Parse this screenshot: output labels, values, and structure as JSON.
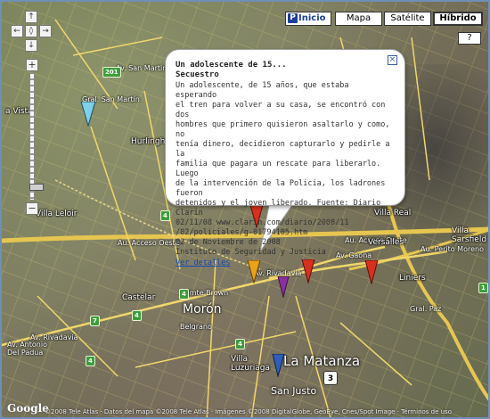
{
  "map_type_controls": {
    "home_label": "Inicio",
    "map_label": "Mapa",
    "satellite_label": "Satélite",
    "hybrid_label": "Híbrido",
    "active": "Híbrido",
    "help_label": "?"
  },
  "nav_controls": {
    "up": "↑",
    "down": "↓",
    "left": "←",
    "right": "→",
    "center": "◊"
  },
  "zoom_controls": {
    "in_label": "+",
    "out_label": "−",
    "level_fraction": 0.92
  },
  "info_window": {
    "title": "Un adolescente de 15...",
    "category": "Secuestro",
    "body_lines": [
      "Un adolescente, de 15 años, que estaba esperando",
      "el tren para volver a su casa, se encontró con dos",
      "hombres que primero quisieron asaltarlo y como, no",
      "tenía dinero, decidieron capturarlo y pedirle a la",
      "familia que pagara un rescate para liberarlo. Luego",
      "de la intervención de la Policía, los ladrones fueron",
      "detenidos y el joven liberado. Fuente: Diario Clarín",
      "02/11/08 www.clarin.com/diario/2008/11",
      "/02/policiales/g-01794105.htm",
      "02 de Noviembre de 2008",
      "Instituto de Seguridad y Justicia"
    ],
    "link_label": "Ver detalles",
    "close_label": "×"
  },
  "places": {
    "hurlingham": "Hurlingham",
    "villa_leloir": "Villa Leloir",
    "castelar": "Castelar",
    "moron": "Morón",
    "la_matanza": "La Matanza",
    "villa_luzuriaga": "Villa\nLuzuriaga",
    "san_justo": "San Justo",
    "villa_real": "Villa Real",
    "versalles": "Versalles",
    "liniers": "Liniers",
    "villa_sarsfield": "Villa\nSarsfield",
    "la_vista": "a Vista"
  },
  "streets": {
    "acceso_oeste_left": "Au. Acceso Oeste",
    "acceso_oeste_right": "Au. Acceso Oeste",
    "perito_moreno": "Au. Perito Moreno",
    "gaona": "Av. Gaona",
    "rivadavia_center": "Av. Rivadavia",
    "rivadavia_left": "Av. Rivadavia",
    "gral_paz": "Gral. Paz",
    "almte_brown": "Almte Brown",
    "gral_san_martin": "Gral. San Martín",
    "av_san_martin": "Av. San Martin",
    "av_antonio_del_padua": "Av. Antonio\nDel Padua",
    "belgrano": "Belgrano",
    "av_rivadavia_lower": "Av. Rivadavia"
  },
  "route_shields": [
    "201",
    "4",
    "7",
    "4",
    "4",
    "4",
    "3",
    "4",
    "1"
  ],
  "markers": [
    {
      "color": "#7fd0e8",
      "name": "marker-cyan"
    },
    {
      "color": "#d9301e",
      "name": "marker-red-1"
    },
    {
      "color": "#e8a21b",
      "name": "marker-orange"
    },
    {
      "color": "#8b2fa0",
      "name": "marker-purple"
    },
    {
      "color": "#d9301e",
      "name": "marker-red-2"
    },
    {
      "color": "#d9301e",
      "name": "marker-red-3"
    },
    {
      "color": "#2f5fb8",
      "name": "marker-blue"
    }
  ],
  "footer": {
    "logo": "Google",
    "copyright": "©2008 Tele Atlas · Datos del mapa ©2008 Tele Atlas · Imágenes ©2008 DigitalGlobe, GeoEye, Cnes/Spot Image · Términos de uso"
  }
}
